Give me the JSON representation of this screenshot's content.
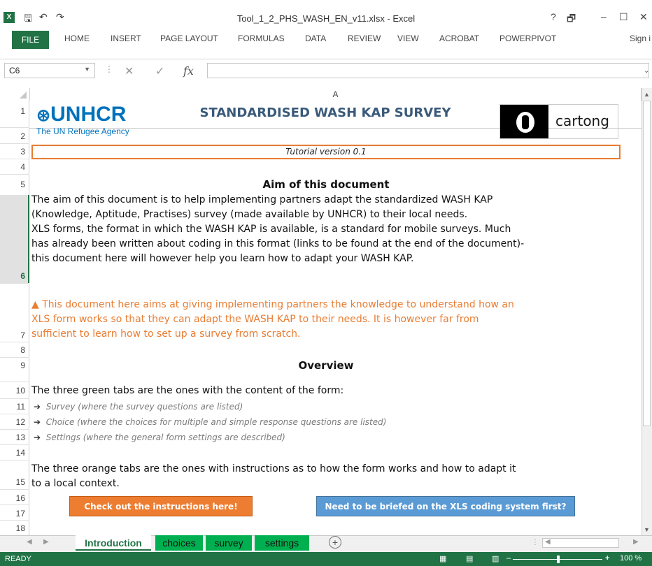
{
  "window": {
    "title": "Tool_1_2_PHS_WASH_EN_v11.xlsx - Excel",
    "app_icon": "excel-icon",
    "controls": {
      "help": "?",
      "restore": "🗗",
      "minimize": "–",
      "maximize": "☐",
      "close": "✕"
    }
  },
  "qat": {
    "save_icon": "save-icon",
    "undo_icon": "undo-icon",
    "redo_icon": "redo-icon"
  },
  "ribbon": {
    "file": "FILE",
    "tabs": [
      "HOME",
      "INSERT",
      "PAGE LAYOUT",
      "FORMULAS",
      "DATA",
      "REVIEW",
      "VIEW",
      "ACROBAT",
      "POWERPIVOT"
    ],
    "signin": "Sign i"
  },
  "formula_bar": {
    "name_box": "C6",
    "fx": "fx",
    "value": ""
  },
  "grid": {
    "column_header": "A",
    "row_numbers": [
      "1",
      "2",
      "3",
      "4",
      "5",
      "6",
      "7",
      "8",
      "9",
      "10",
      "11",
      "12",
      "13",
      "14",
      "15",
      "16",
      "17",
      "18"
    ]
  },
  "doc": {
    "logo_main": "UNHCR",
    "logo_sub": "The UN Refugee Agency",
    "title": "STANDARDISED WASH KAP SURVEY",
    "partner_logo": "cartong",
    "tutorial": "Tutorial version 0.1",
    "aim_heading": "Aim of this document",
    "aim_body": [
      "The aim of this document is to help implementing partners adapt the standardized WASH KAP",
      "(Knowledge, Aptitude, Practises) survey (made available by UNHCR) to their local needs.",
      "XLS forms, the format in which the WASH KAP is available, is a standard for mobile surveys. Much",
      "has already been written about coding in this format (links to be found at the end of the document)-",
      "this document here will however help you learn how to adapt your WASH KAP."
    ],
    "warning_icon": "warning-icon",
    "warning": [
      "This document here aims at giving implementing partners the knowledge to understand how an",
      "XLS form works so that they can adapt the WASH KAP to their needs. It is however far from",
      "sufficient to learn how to set up a survey from scratch."
    ],
    "overview_heading": "Overview",
    "green_intro": "The three green tabs are the ones with the content of the form:",
    "bullets": [
      "Survey (where the survey questions are listed)",
      "Choice (where the choices for multiple and simple response questions are listed)",
      "Settings (where the general form settings are described)"
    ],
    "orange_intro": [
      "The three orange tabs are the ones with instructions as to how the form works and how to adapt it",
      "to a local context."
    ],
    "btn_instructions": "Check out the instructions  here!",
    "btn_briefed": "Need to be briefed on the XLS coding system first?"
  },
  "sheets": {
    "active": "Introduction",
    "tabs": [
      "choices",
      "survey",
      "settings"
    ],
    "add": "+"
  },
  "status": {
    "ready": "READY",
    "zoom": "100 %",
    "zoom_minus": "–",
    "zoom_plus": "+"
  },
  "colors": {
    "excel_green": "#217346",
    "accent_orange": "#ed7d31",
    "accent_blue": "#5b9bd5",
    "tab_green": "#00b050"
  }
}
